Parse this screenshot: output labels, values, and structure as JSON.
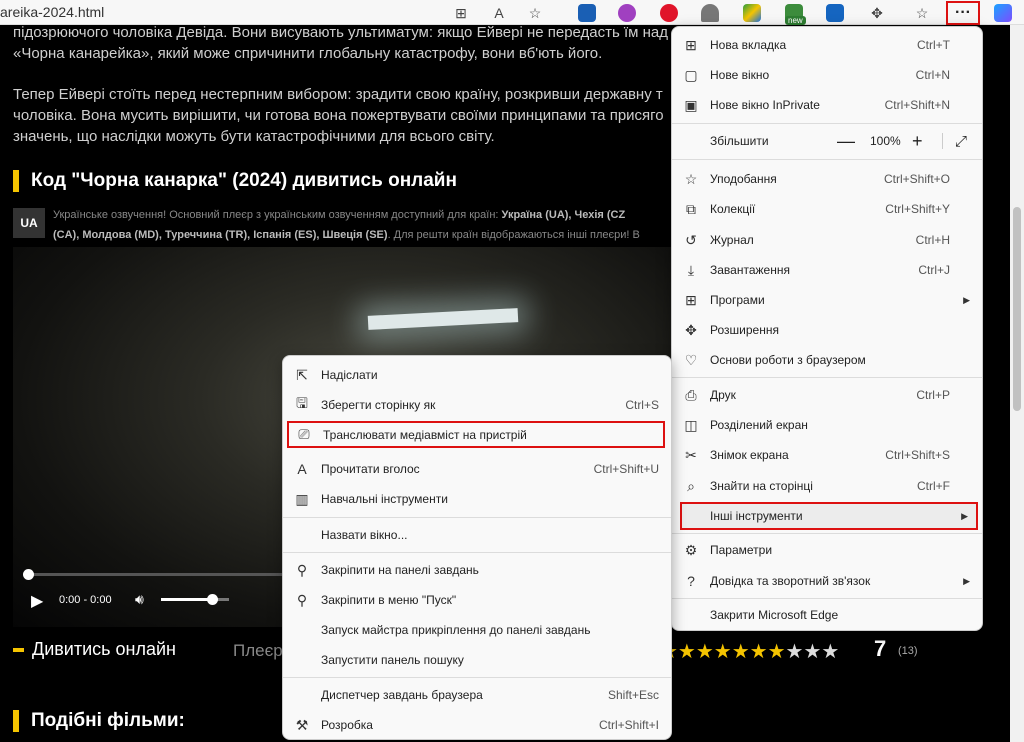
{
  "browser": {
    "url": "areika-2024.html",
    "extensions": [
      {
        "name": "ext-dictionary",
        "color": "#1a5fb4"
      },
      {
        "name": "ext-colorpicker",
        "color": "#a040c0"
      },
      {
        "name": "ext-opera",
        "color": "#e0142a"
      },
      {
        "name": "ext-arc",
        "color": "#777777"
      },
      {
        "name": "ext-drive",
        "color": "#2a9d3e"
      },
      {
        "name": "ext-new",
        "color": "#3c8c3c"
      },
      {
        "name": "ext-id",
        "color": "#1565c0"
      },
      {
        "name": "ext-puzzle",
        "color": "#444444"
      }
    ],
    "new_badge": "new",
    "more_glyph": "···"
  },
  "page": {
    "para1_line1": "підозрюючого чоловіка Девіда. Вони висувають ультиматум: якщо Ейвері не передасть їм над",
    "para1_line2": "«Чорна канарейка», який може спричинити глобальну катастрофу, вони вб'ють його.",
    "para2_line1": "Тепер Ейвері стоїть перед нестерпним вибором: зрадити свою країну, розкривши державну т",
    "para2_line2": "чоловіка. Вона мусить вирішити, чи готова вона пожертвувати своїми принципами та присяго",
    "para2_line3": "значень, що наслідки можуть бути катастрофічними для всього світу.",
    "heading": "Код \"Чорна канарка\" (2024) дивитись онлайн",
    "ua_badge": "UA",
    "ua_line1_prefix": "Українське озвучення! Основний плеєр з українським озвученням доступний для країн: ",
    "ua_line1_bold": "Україна (UA), Чехія (CZ",
    "ua_line2_bold": "(CA), Молдова (MD), Туреччина (TR), Іспанія (ES), Швеція (SE)",
    "ua_line2_suffix": ". Для решти країн відображаються інші плеєри! В",
    "player": {
      "time": "0:00 - 0:00",
      "progress": 0,
      "volume": 0.75
    },
    "watch_tab": "Дивитись онлайн",
    "player_tab": "Плеєр",
    "rating": {
      "stars_filled": "★★★★★★★",
      "stars_empty": "★★★",
      "value": "7",
      "count": "(13)"
    },
    "similar_heading": "Подібні фільми:"
  },
  "main_menu": {
    "items": [
      {
        "icon": "new-tab-icon",
        "glyph": "⊞",
        "label": "Нова вкладка",
        "shortcut": "Ctrl+T"
      },
      {
        "icon": "new-window-icon",
        "glyph": "▢",
        "label": "Нове вікно",
        "shortcut": "Ctrl+N"
      },
      {
        "icon": "inprivate-icon",
        "glyph": "▣",
        "label": "Нове вікно InPrivate",
        "shortcut": "Ctrl+Shift+N"
      },
      {
        "icon": "zoom-icon",
        "glyph": "",
        "label": "Збільшити",
        "shortcut": ""
      },
      {
        "icon": "favorites-icon",
        "glyph": "☆",
        "label": "Уподобання",
        "shortcut": "Ctrl+Shift+O"
      },
      {
        "icon": "collections-icon",
        "glyph": "⧉",
        "label": "Колекції",
        "shortcut": "Ctrl+Shift+Y"
      },
      {
        "icon": "history-icon",
        "glyph": "↺",
        "label": "Журнал",
        "shortcut": "Ctrl+H"
      },
      {
        "icon": "download-icon",
        "glyph": "⤓",
        "label": "Завантаження",
        "shortcut": "Ctrl+J"
      },
      {
        "icon": "apps-icon",
        "glyph": "⊞",
        "label": "Програми",
        "shortcut": ""
      },
      {
        "icon": "extensions-icon",
        "glyph": "✥",
        "label": "Розширення",
        "shortcut": ""
      },
      {
        "icon": "browser-essentials-icon",
        "glyph": "♡",
        "label": "Основи роботи з браузером",
        "shortcut": ""
      },
      {
        "icon": "print-icon",
        "glyph": "⎙",
        "label": "Друк",
        "shortcut": "Ctrl+P"
      },
      {
        "icon": "split-screen-icon",
        "glyph": "◫",
        "label": "Розділений екран",
        "shortcut": ""
      },
      {
        "icon": "screenshot-icon",
        "glyph": "✂",
        "label": "Знімок екрана",
        "shortcut": "Ctrl+Shift+S"
      },
      {
        "icon": "find-icon",
        "glyph": "⌕",
        "label": "Знайти на сторінці",
        "shortcut": "Ctrl+F"
      },
      {
        "icon": "more-tools-icon",
        "glyph": "",
        "label": "Інші інструменти",
        "shortcut": ""
      },
      {
        "icon": "settings-icon",
        "glyph": "⚙",
        "label": "Параметри",
        "shortcut": ""
      },
      {
        "icon": "help-icon",
        "glyph": "?",
        "label": "Довідка та зворотний зв'язок",
        "shortcut": ""
      },
      {
        "icon": "close-edge-icon",
        "glyph": "",
        "label": "Закрити Microsoft Edge",
        "shortcut": ""
      }
    ],
    "zoom_value": "100%",
    "zoom_minus": "—",
    "zoom_plus": "+",
    "zoom_expand": "⤢"
  },
  "sub_menu": {
    "items": [
      {
        "icon": "share-icon",
        "glyph": "⇱",
        "label": "Надіслати",
        "shortcut": ""
      },
      {
        "icon": "save-page-icon",
        "glyph": "🖫",
        "label": "Зберегти сторінку як",
        "shortcut": "Ctrl+S"
      },
      {
        "icon": "cast-icon",
        "glyph": "⎚",
        "label": "Транслювати медіавміст на пристрій",
        "shortcut": ""
      },
      {
        "icon": "read-aloud-icon",
        "glyph": "A",
        "label": "Прочитати вголос",
        "shortcut": "Ctrl+Shift+U"
      },
      {
        "icon": "learning-tools-icon",
        "glyph": "▥",
        "label": "Навчальні інструменти",
        "shortcut": ""
      },
      {
        "icon": "",
        "glyph": "",
        "label": "Назвати вікно...",
        "shortcut": ""
      },
      {
        "icon": "pin-taskbar-icon",
        "glyph": "⚲",
        "label": "Закріпити на панелі завдань",
        "shortcut": ""
      },
      {
        "icon": "pin-start-icon",
        "glyph": "⚲",
        "label": "Закріпити в меню \"Пуск\"",
        "shortcut": ""
      },
      {
        "icon": "",
        "glyph": "",
        "label": "Запуск майстра прикріплення до панелі завдань",
        "shortcut": ""
      },
      {
        "icon": "",
        "glyph": "",
        "label": "Запустити панель пошуку",
        "shortcut": ""
      },
      {
        "icon": "",
        "glyph": "",
        "label": "Диспетчер завдань браузера",
        "shortcut": "Shift+Esc"
      },
      {
        "icon": "devtools-icon",
        "glyph": "⚒",
        "label": "Розробка",
        "shortcut": "Ctrl+Shift+I"
      }
    ]
  },
  "colors": {
    "accent": "#f5c400",
    "highlight_border": "#dd1111"
  }
}
